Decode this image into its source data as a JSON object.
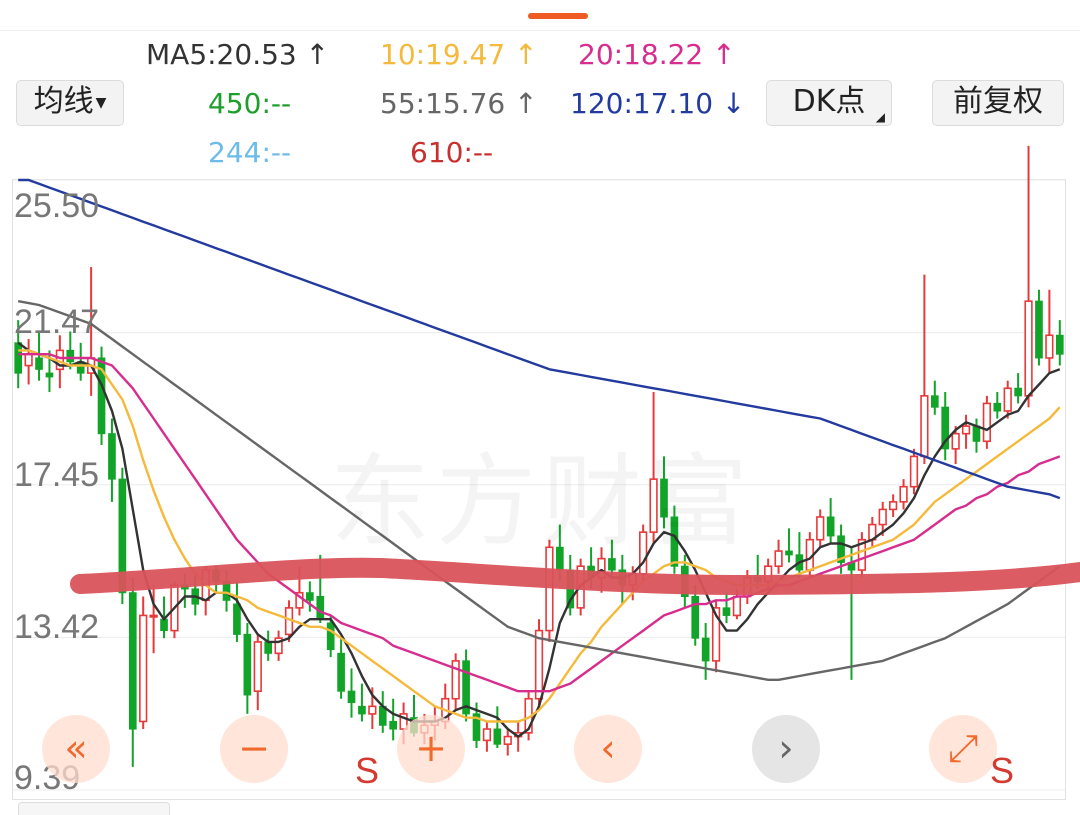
{
  "ma_type_button": {
    "label": "均线"
  },
  "dk_button": {
    "label": "DK点"
  },
  "rights_button": {
    "label": "前复权"
  },
  "ma_values": {
    "ma5": {
      "label": "MA5:20.53 ↑",
      "color": "#333333"
    },
    "ma10": {
      "label": "10:19.47 ↑",
      "color": "#f5b93b"
    },
    "ma20": {
      "label": "20:18.22 ↑",
      "color": "#d72d8e"
    },
    "ma450": {
      "label": "450:--",
      "color": "#1f9e2b"
    },
    "ma55": {
      "label": "55:15.76 ↑",
      "color": "#666666"
    },
    "ma120": {
      "label": "120:17.10 ↓",
      "color": "#233a9e"
    },
    "ma244": {
      "label": "244:--",
      "color": "#6cbbe8"
    },
    "ma610": {
      "label": "610:--",
      "color": "#c8302f"
    }
  },
  "colors": {
    "up": "#e8393a",
    "down": "#12a428",
    "drawn_line": "#d9535a"
  },
  "watermark": "东方财富",
  "controls": {
    "rewind_icon": "«",
    "zoom_out_icon": "−",
    "zoom_in_icon": "+",
    "prev_icon": "‹",
    "next_icon": "›",
    "fullscreen_icon": "⤢"
  },
  "markers": {
    "s1": "S",
    "s2": "S"
  },
  "chart_data": {
    "type": "candlestick",
    "ylim": [
      9.39,
      25.5
    ],
    "y_ticks": [
      "25.50",
      "21.47",
      "17.45",
      "13.42",
      "9.39"
    ],
    "grid": true,
    "candles": [
      [
        21.2,
        21.8,
        20.0,
        20.4
      ],
      [
        20.6,
        21.3,
        20.1,
        20.9
      ],
      [
        20.8,
        21.5,
        20.2,
        20.5
      ],
      [
        20.4,
        21.0,
        19.9,
        20.3
      ],
      [
        20.5,
        21.4,
        20.0,
        21.0
      ],
      [
        21.0,
        21.5,
        20.5,
        20.7
      ],
      [
        20.7,
        21.2,
        20.2,
        20.4
      ],
      [
        20.4,
        23.2,
        19.8,
        20.8
      ],
      [
        20.8,
        21.1,
        18.5,
        18.8
      ],
      [
        18.8,
        19.2,
        17.0,
        17.6
      ],
      [
        17.6,
        17.9,
        14.3,
        14.6
      ],
      [
        14.6,
        15.0,
        10.0,
        11.0
      ],
      [
        11.2,
        14.5,
        11.0,
        14.0
      ],
      [
        14.0,
        14.8,
        13.0,
        14.0
      ],
      [
        13.9,
        14.5,
        13.4,
        13.6
      ],
      [
        13.6,
        14.9,
        13.4,
        14.8
      ],
      [
        14.8,
        15.1,
        14.2,
        14.7
      ],
      [
        14.7,
        15.1,
        14.0,
        14.3
      ],
      [
        14.4,
        15.3,
        14.0,
        15.2
      ],
      [
        15.2,
        15.3,
        14.6,
        14.9
      ],
      [
        14.9,
        15.2,
        14.1,
        14.4
      ],
      [
        14.3,
        14.9,
        13.3,
        13.5
      ],
      [
        13.5,
        13.8,
        11.4,
        11.9
      ],
      [
        12.0,
        13.5,
        11.5,
        13.3
      ],
      [
        13.3,
        13.6,
        12.8,
        13.0
      ],
      [
        13.0,
        13.6,
        12.8,
        13.4
      ],
      [
        13.5,
        14.4,
        13.3,
        14.2
      ],
      [
        14.2,
        15.3,
        14.0,
        14.6
      ],
      [
        14.6,
        14.9,
        14.1,
        14.4
      ],
      [
        14.5,
        15.6,
        13.8,
        13.9
      ],
      [
        13.8,
        14.0,
        12.9,
        13.1
      ],
      [
        13.0,
        13.4,
        11.8,
        12.0
      ],
      [
        12.0,
        12.6,
        11.3,
        11.7
      ],
      [
        11.6,
        12.2,
        11.2,
        11.4
      ],
      [
        11.4,
        12.1,
        11.0,
        11.6
      ],
      [
        11.6,
        12.0,
        10.9,
        11.1
      ],
      [
        11.2,
        11.8,
        10.7,
        11.0
      ],
      [
        11.0,
        11.7,
        10.6,
        11.4
      ],
      [
        11.3,
        11.9,
        10.8,
        10.9
      ],
      [
        10.9,
        11.4,
        10.6,
        11.1
      ],
      [
        11.1,
        11.6,
        10.7,
        11.2
      ],
      [
        11.2,
        12.2,
        11.0,
        11.8
      ],
      [
        11.8,
        13.0,
        11.5,
        12.8
      ],
      [
        12.8,
        13.1,
        11.2,
        11.4
      ],
      [
        11.4,
        11.7,
        10.5,
        10.7
      ],
      [
        10.7,
        11.2,
        10.4,
        11.0
      ],
      [
        11.0,
        11.6,
        10.5,
        10.6
      ],
      [
        10.6,
        11.0,
        10.3,
        10.8
      ],
      [
        10.8,
        11.2,
        10.4,
        10.9
      ],
      [
        10.9,
        12.0,
        10.7,
        11.8
      ],
      [
        11.8,
        13.9,
        11.6,
        13.6
      ],
      [
        13.6,
        16.0,
        13.3,
        15.8
      ],
      [
        15.8,
        16.4,
        14.9,
        15.2
      ],
      [
        15.2,
        15.6,
        14.0,
        14.2
      ],
      [
        14.2,
        15.5,
        14.0,
        15.3
      ],
      [
        15.3,
        15.8,
        14.7,
        15.0
      ],
      [
        15.0,
        15.8,
        14.6,
        15.5
      ],
      [
        15.5,
        16.0,
        15.0,
        15.2
      ],
      [
        15.2,
        15.6,
        14.3,
        14.8
      ],
      [
        14.8,
        15.3,
        14.4,
        15.1
      ],
      [
        15.1,
        16.4,
        14.9,
        16.2
      ],
      [
        16.2,
        19.9,
        15.9,
        17.6
      ],
      [
        17.6,
        18.2,
        16.3,
        16.6
      ],
      [
        16.6,
        16.9,
        15.1,
        15.3
      ],
      [
        15.3,
        15.6,
        14.2,
        14.5
      ],
      [
        14.5,
        14.8,
        13.2,
        13.4
      ],
      [
        13.4,
        13.8,
        12.3,
        12.8
      ],
      [
        12.8,
        14.4,
        12.5,
        14.2
      ],
      [
        14.2,
        14.6,
        13.8,
        14.0
      ],
      [
        14.0,
        14.7,
        13.9,
        14.5
      ],
      [
        14.5,
        15.2,
        14.3,
        15.0
      ],
      [
        15.0,
        15.6,
        14.7,
        14.9
      ],
      [
        14.9,
        15.5,
        14.7,
        15.3
      ],
      [
        15.3,
        16.0,
        15.1,
        15.7
      ],
      [
        15.7,
        16.3,
        15.4,
        15.6
      ],
      [
        15.6,
        16.2,
        15.0,
        15.2
      ],
      [
        15.2,
        16.2,
        15.0,
        16.0
      ],
      [
        16.0,
        16.8,
        15.8,
        16.6
      ],
      [
        16.6,
        17.1,
        15.9,
        16.1
      ],
      [
        16.1,
        16.4,
        15.1,
        15.4
      ],
      [
        15.4,
        15.8,
        12.3,
        15.2
      ],
      [
        15.2,
        16.2,
        15.0,
        16.0
      ],
      [
        16.0,
        16.6,
        15.8,
        16.4
      ],
      [
        16.4,
        17.0,
        16.1,
        16.8
      ],
      [
        16.8,
        17.2,
        16.6,
        17.0
      ],
      [
        17.0,
        17.6,
        16.8,
        17.4
      ],
      [
        17.4,
        18.4,
        17.2,
        18.2
      ],
      [
        18.2,
        23.0,
        18.0,
        19.8
      ],
      [
        19.8,
        20.2,
        19.3,
        19.5
      ],
      [
        19.5,
        19.9,
        18.1,
        18.4
      ],
      [
        18.4,
        19.0,
        18.0,
        18.8
      ],
      [
        18.8,
        19.3,
        18.4,
        19.0
      ],
      [
        19.0,
        19.2,
        18.3,
        18.6
      ],
      [
        18.6,
        19.8,
        18.4,
        19.6
      ],
      [
        19.6,
        19.9,
        19.2,
        19.4
      ],
      [
        19.4,
        20.2,
        19.2,
        20.0
      ],
      [
        20.0,
        20.4,
        19.6,
        19.8
      ],
      [
        19.8,
        26.4,
        19.5,
        22.3
      ],
      [
        22.3,
        22.6,
        20.6,
        20.8
      ],
      [
        20.8,
        22.6,
        20.4,
        21.4
      ],
      [
        21.4,
        21.8,
        20.6,
        20.9
      ]
    ],
    "series": [
      {
        "key": "ma5",
        "values": [
          21.2,
          21.0,
          20.9,
          20.8,
          20.6,
          20.6,
          20.7,
          20.6,
          20.1,
          19.4,
          18.4,
          16.8,
          15.2,
          14.3,
          13.9,
          14.2,
          14.5,
          14.5,
          14.4,
          14.6,
          14.6,
          14.4,
          13.9,
          13.5,
          13.3,
          13.3,
          13.4,
          13.7,
          13.9,
          13.9,
          13.9,
          13.5,
          13.0,
          12.4,
          11.9,
          11.6,
          11.4,
          11.3,
          11.2,
          11.2,
          11.2,
          11.3,
          11.5,
          11.6,
          11.5,
          11.4,
          11.3,
          11.0,
          10.8,
          11.0,
          11.6,
          12.6,
          13.8,
          14.4,
          14.8,
          15.0,
          15.2,
          15.0,
          15.0,
          15.1,
          15.4,
          15.9,
          16.2,
          16.1,
          15.7,
          15.2,
          14.6,
          14.0,
          13.6,
          13.6,
          13.9,
          14.3,
          14.6,
          14.9,
          15.2,
          15.4,
          15.5,
          15.8,
          15.9,
          15.9,
          15.8,
          15.9,
          16.0,
          16.2,
          16.4,
          16.7,
          17.1,
          17.7,
          18.2,
          18.6,
          18.9,
          19.1,
          19.0,
          18.9,
          19.1,
          19.3,
          19.4,
          19.8,
          20.1,
          20.4,
          20.5
        ]
      },
      {
        "key": "ma10",
        "values": [
          21.0,
          21.0,
          20.9,
          20.8,
          20.7,
          20.6,
          20.6,
          20.6,
          20.5,
          20.1,
          19.7,
          19.0,
          18.1,
          17.3,
          16.6,
          16.0,
          15.5,
          15.1,
          14.8,
          14.6,
          14.6,
          14.5,
          14.4,
          14.2,
          14.1,
          14.0,
          13.9,
          13.8,
          13.7,
          13.7,
          13.6,
          13.4,
          13.2,
          13.0,
          12.8,
          12.6,
          12.4,
          12.2,
          12.0,
          11.8,
          11.6,
          11.5,
          11.4,
          11.3,
          11.3,
          11.2,
          11.2,
          11.2,
          11.2,
          11.3,
          11.5,
          11.8,
          12.2,
          12.6,
          13.0,
          13.3,
          13.7,
          14.0,
          14.3,
          14.6,
          14.9,
          15.1,
          15.3,
          15.4,
          15.4,
          15.3,
          15.2,
          15.0,
          14.9,
          14.8,
          14.8,
          14.8,
          14.8,
          14.9,
          15.0,
          15.1,
          15.2,
          15.3,
          15.4,
          15.5,
          15.6,
          15.7,
          15.8,
          15.9,
          16.0,
          16.2,
          16.4,
          16.7,
          17.0,
          17.2,
          17.4,
          17.6,
          17.8,
          18.0,
          18.2,
          18.4,
          18.6,
          18.8,
          19.0,
          19.2,
          19.5
        ]
      },
      {
        "key": "ma20",
        "values": [
          20.9,
          20.9,
          20.9,
          20.9,
          20.8,
          20.8,
          20.8,
          20.8,
          20.7,
          20.6,
          20.3,
          20.0,
          19.6,
          19.2,
          18.8,
          18.4,
          18.0,
          17.6,
          17.2,
          16.8,
          16.4,
          16.0,
          15.7,
          15.4,
          15.1,
          14.9,
          14.7,
          14.5,
          14.3,
          14.1,
          14.0,
          13.8,
          13.7,
          13.6,
          13.5,
          13.4,
          13.2,
          13.1,
          13.0,
          12.9,
          12.8,
          12.7,
          12.6,
          12.5,
          12.4,
          12.3,
          12.2,
          12.1,
          12.0,
          12.0,
          12.0,
          12.0,
          12.1,
          12.2,
          12.4,
          12.6,
          12.8,
          13.0,
          13.2,
          13.4,
          13.6,
          13.8,
          14.0,
          14.1,
          14.2,
          14.3,
          14.3,
          14.4,
          14.4,
          14.5,
          14.5,
          14.6,
          14.7,
          14.8,
          14.8,
          14.9,
          15.0,
          15.1,
          15.2,
          15.3,
          15.4,
          15.5,
          15.6,
          15.7,
          15.8,
          15.9,
          16.0,
          16.2,
          16.4,
          16.6,
          16.8,
          16.9,
          17.1,
          17.2,
          17.4,
          17.5,
          17.7,
          17.8,
          18.0,
          18.1,
          18.2
        ]
      },
      {
        "key": "ma55",
        "values": [
          22.3,
          22.25,
          22.2,
          22.1,
          22.0,
          21.9,
          21.8,
          21.7,
          21.5,
          21.3,
          21.1,
          20.9,
          20.7,
          20.5,
          20.3,
          20.1,
          19.9,
          19.7,
          19.5,
          19.3,
          19.1,
          18.9,
          18.7,
          18.5,
          18.3,
          18.1,
          17.9,
          17.7,
          17.5,
          17.3,
          17.1,
          16.9,
          16.7,
          16.5,
          16.3,
          16.1,
          15.9,
          15.7,
          15.5,
          15.3,
          15.1,
          14.9,
          14.7,
          14.5,
          14.3,
          14.1,
          13.9,
          13.7,
          13.6,
          13.5,
          13.4,
          13.35,
          13.3,
          13.25,
          13.2,
          13.15,
          13.1,
          13.05,
          13.0,
          12.95,
          12.9,
          12.85,
          12.8,
          12.75,
          12.7,
          12.65,
          12.6,
          12.55,
          12.5,
          12.45,
          12.4,
          12.35,
          12.3,
          12.3,
          12.35,
          12.4,
          12.45,
          12.5,
          12.55,
          12.6,
          12.65,
          12.7,
          12.75,
          12.8,
          12.9,
          13.0,
          13.1,
          13.2,
          13.3,
          13.4,
          13.55,
          13.7,
          13.85,
          14.0,
          14.15,
          14.3,
          14.5,
          14.7,
          14.9,
          15.1,
          15.3
        ]
      },
      {
        "key": "ma120",
        "values": [
          25.6,
          25.5,
          25.4,
          25.3,
          25.2,
          25.1,
          25.0,
          24.9,
          24.8,
          24.7,
          24.6,
          24.5,
          24.4,
          24.3,
          24.2,
          24.1,
          24.0,
          23.9,
          23.8,
          23.7,
          23.6,
          23.5,
          23.4,
          23.3,
          23.2,
          23.1,
          23.0,
          22.9,
          22.8,
          22.7,
          22.6,
          22.5,
          22.4,
          22.3,
          22.2,
          22.1,
          22.0,
          21.9,
          21.8,
          21.7,
          21.6,
          21.5,
          21.4,
          21.3,
          21.2,
          21.1,
          21.0,
          20.9,
          20.8,
          20.7,
          20.6,
          20.5,
          20.45,
          20.4,
          20.35,
          20.3,
          20.25,
          20.2,
          20.15,
          20.1,
          20.05,
          20.0,
          19.95,
          19.9,
          19.85,
          19.8,
          19.75,
          19.7,
          19.65,
          19.6,
          19.55,
          19.5,
          19.45,
          19.4,
          19.35,
          19.3,
          19.25,
          19.2,
          19.1,
          19.0,
          18.9,
          18.8,
          18.7,
          18.6,
          18.5,
          18.4,
          18.3,
          18.2,
          18.1,
          18.0,
          17.9,
          17.8,
          17.7,
          17.6,
          17.5,
          17.4,
          17.35,
          17.3,
          17.25,
          17.2,
          17.1
        ]
      }
    ]
  }
}
